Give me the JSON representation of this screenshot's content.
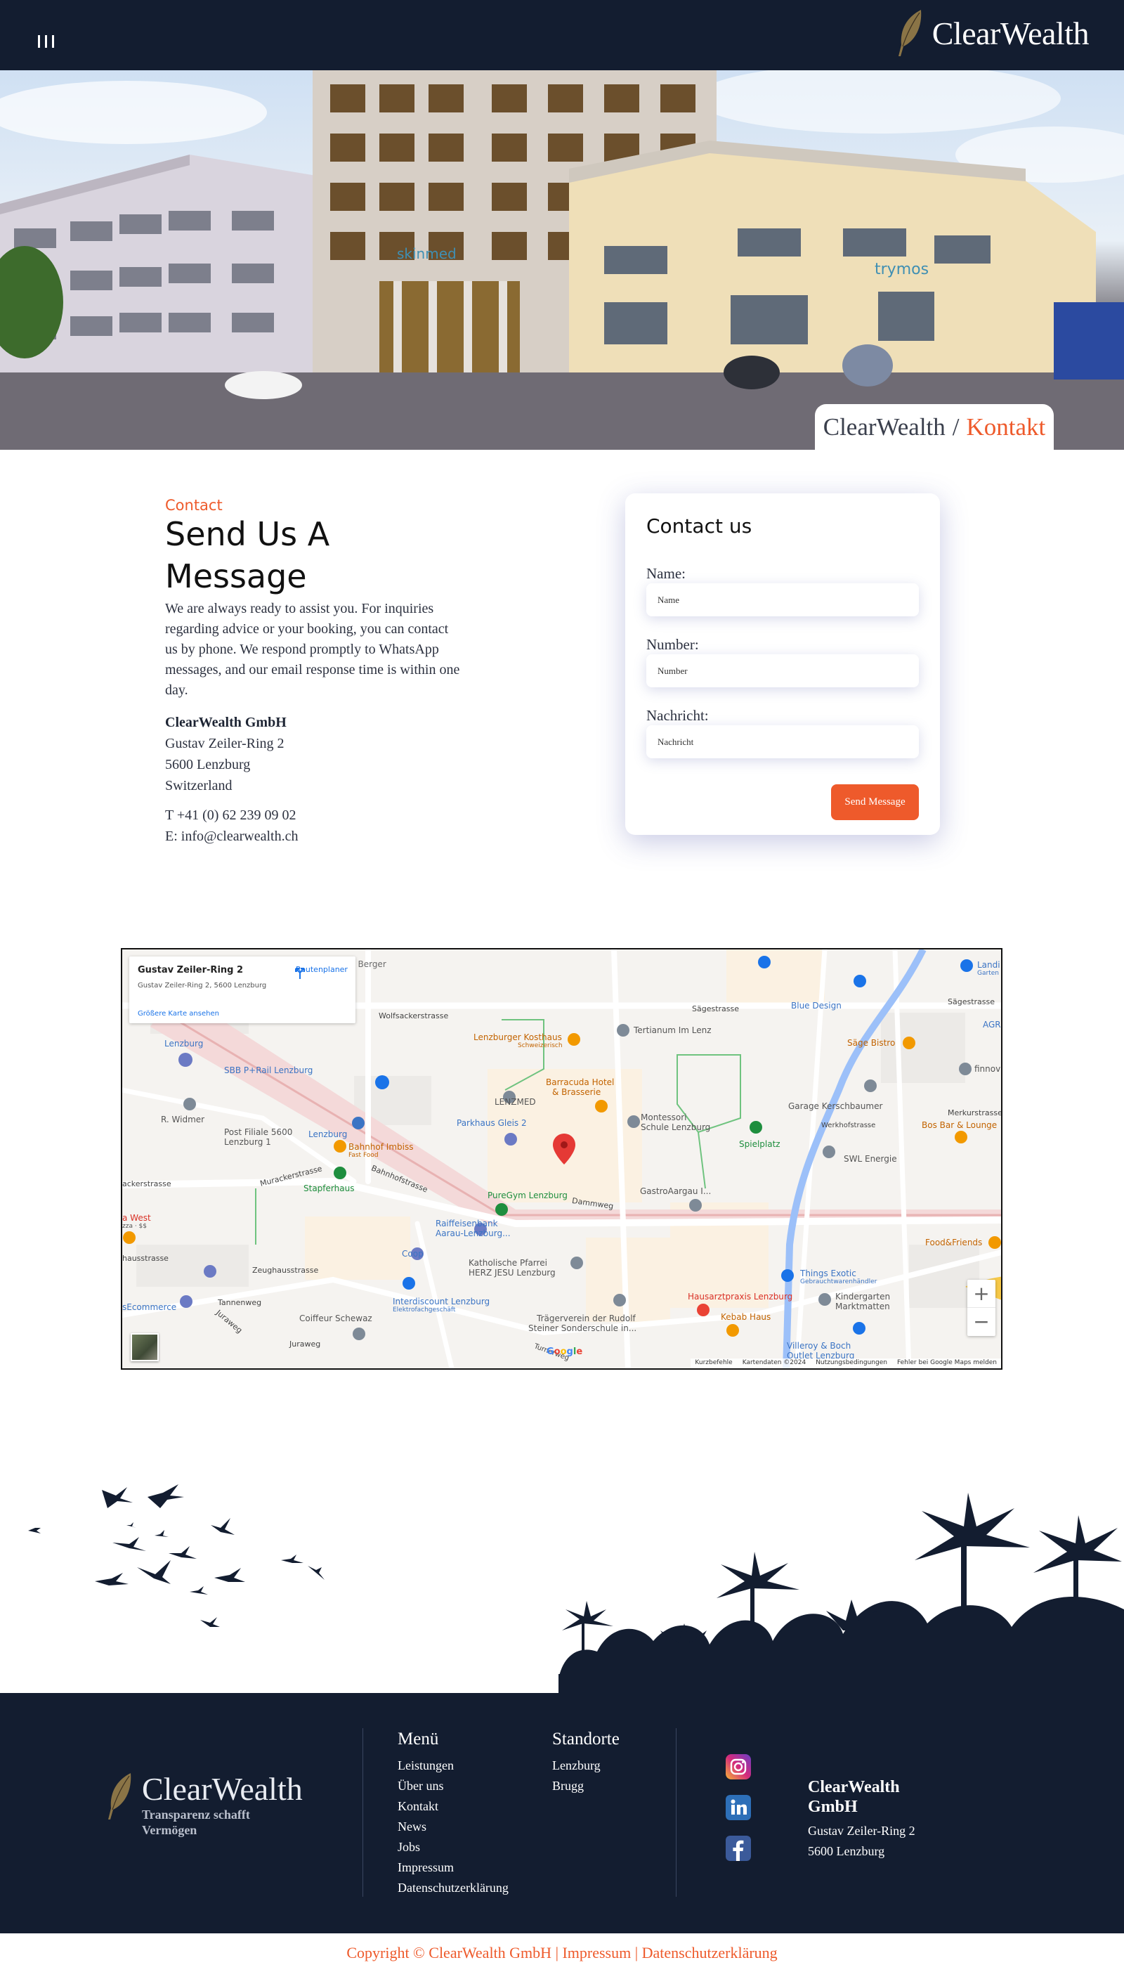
{
  "header": {
    "brand_name": "ClearWealth",
    "menu_icon": "hamburger-menu-icon",
    "logo_icon": "feather-icon"
  },
  "hero": {
    "breadcrumb_home": "ClearWealth",
    "breadcrumb_separator": "/",
    "breadcrumb_current": "Kontakt"
  },
  "contact": {
    "eyebrow": "Contact",
    "heading": "Send Us A Message",
    "intro": "We are always ready to assist you. For inquiries regarding advice or your booking, you can contact us by phone. We respond promptly to WhatsApp messages, and our email response time is within one day.",
    "company": "ClearWealth GmbH",
    "street": "Gustav Zeiler-Ring 2",
    "city": "5600 Lenzburg",
    "country": "Switzerland",
    "phone": "T +41 (0) 62 239 09 02",
    "email": "E: info@clearwealth.ch"
  },
  "form": {
    "title": "Contact us",
    "name_label": "Name:",
    "name_placeholder": "Name",
    "number_label": "Number:",
    "number_placeholder": "Number",
    "message_label": "Nachricht:",
    "message_placeholder": "Nachricht",
    "submit": "Send Message"
  },
  "map": {
    "place_title": "Gustav Zeiler-Ring 2",
    "place_address": "Gustav Zeiler-Ring 2, 5600 Lenzburg",
    "larger_map": "Größere Karte ansehen",
    "directions": "Routenplaner",
    "zoom_in": "+",
    "zoom_out": "−",
    "google": [
      "G",
      "o",
      "o",
      "g",
      "l",
      "e"
    ],
    "attribution": [
      "Kurzbefehle",
      "Kartendaten ©2024",
      "Nutzungsbedingungen",
      "Fehler bei Google Maps melden"
    ],
    "labels": {
      "coiffeur_gabi": "Coiffeur Gabi Berger",
      "wolfsackerstrasse": "Wolfsackerstrasse",
      "lenzburg_poi": "Lenzburg",
      "sbb_rail": "SBB P+Rail Lenzburg",
      "r_widmer": "R. Widmer",
      "post": "Post Filiale 5600",
      "post2": "Lenzburg 1",
      "lenzburg_station": "Lenzburg",
      "murackerstrasse": "Murackerstrasse",
      "stapferhaus": "Stapferhaus",
      "bahnhofstrasse": "Bahnhofstrasse",
      "lenzburger_kosthaus": "Lenzburger Kosthaus",
      "lenzburger_kosthaus2": "Schweizerisch",
      "tertianum": "Tertianum Im Lenz",
      "barracuda": "Barracuda Hotel",
      "barracuda2": "& Brasserie",
      "lenzmed": "LENZMED",
      "parkhaus": "Parkhaus Gleis 2",
      "bahnhof_imbiss": "Bahnhof Imbiss",
      "bahnhof_imbiss2": "Fast Food",
      "montessori": "Montessori",
      "montessori2": "Schule Lenzburg",
      "spielplatz": "Spielplatz",
      "puregym": "PureGym Lenzburg",
      "gastroaargau": "GastroAargau I...",
      "raiffeisen": "Raiffeisenbank",
      "raiffeisen2": "Aarau-Lenzburg...",
      "coop": "Coop",
      "katholische": "Katholische Pfarrei",
      "katholische2": "HERZ JESU Lenzburg",
      "interdiscount": "Interdiscount Lenzburg",
      "interdiscount2": "Elektrofachgeschäft",
      "coiffeur_schewaz": "Coiffeur Schewaz",
      "traegerverein": "Trägerverein der Rudolf",
      "traegerverein2": "Steiner Sonderschule in...",
      "hausarzt": "Hausarztpraxis Lenzburg",
      "kebab": "Kebab Haus",
      "kindergarten": "Kindergarten",
      "kindergarten2": "Marktmatten",
      "things_exotic": "Things Exotic",
      "things_exotic2": "Gebrauchtwarenhändler",
      "villeroy": "Villeroy & Boch",
      "villeroy2": "Outlet Lenzburg",
      "blue_design": "Blue Design",
      "saege_bistro": "Säge Bistro",
      "garage": "Garage Kerschbaumer",
      "swl": "SWL Energie",
      "bos_bar": "Bos Bar & Lounge",
      "food_friends": "Food&Friends",
      "sagestrasse": "Sägestrasse",
      "sagestrasse2": "Sägestrasse",
      "werkhofstrasse": "Werkhofstrasse",
      "merkurstrasse": "Merkurstrasse",
      "dammweg": "Dammweg",
      "zeughausstrasse": "Zeughausstrasse",
      "tannenweg": "Tannenweg",
      "juraweg": "Juraweg",
      "juraweg2": "Juraweg",
      "ecommerce": "sEcommerce",
      "west": "a West",
      "west2": "zza · $$",
      "hausstrasse": "hausstrasse",
      "ackerstrasse": "ackerstrasse",
      "landi": "Landi",
      "landi2": "Garten",
      "agr": "AGR",
      "finnova": "finnova",
      "turnerweg": "Turnerweg"
    }
  },
  "footer": {
    "logo_name": "ClearWealth",
    "tagline": "Transparenz schafft Vermögen",
    "menu_title": "Menü",
    "menu_items": [
      "Leistungen",
      "Über uns",
      "Kontakt",
      "News",
      "Jobs",
      "Impressum",
      "Datenschutzerklärung"
    ],
    "locations_title": "Standorte",
    "locations": [
      "Lenzburg",
      "Brugg"
    ],
    "social_icons": [
      "instagram-icon",
      "linkedin-icon",
      "facebook-icon"
    ],
    "company": "ClearWealth GmbH",
    "street": "Gustav Zeiler-Ring 2",
    "city": "5600 Lenzburg"
  },
  "copyright": {
    "text": "Copyright © ClearWealth GmbH",
    "sep1": "|",
    "impressum": "Impressum",
    "sep2": "|",
    "privacy": "Datenschutzerklärung"
  },
  "colors": {
    "navy": "#131d30",
    "accent": "#ee5a2b",
    "white": "#ffffff"
  }
}
